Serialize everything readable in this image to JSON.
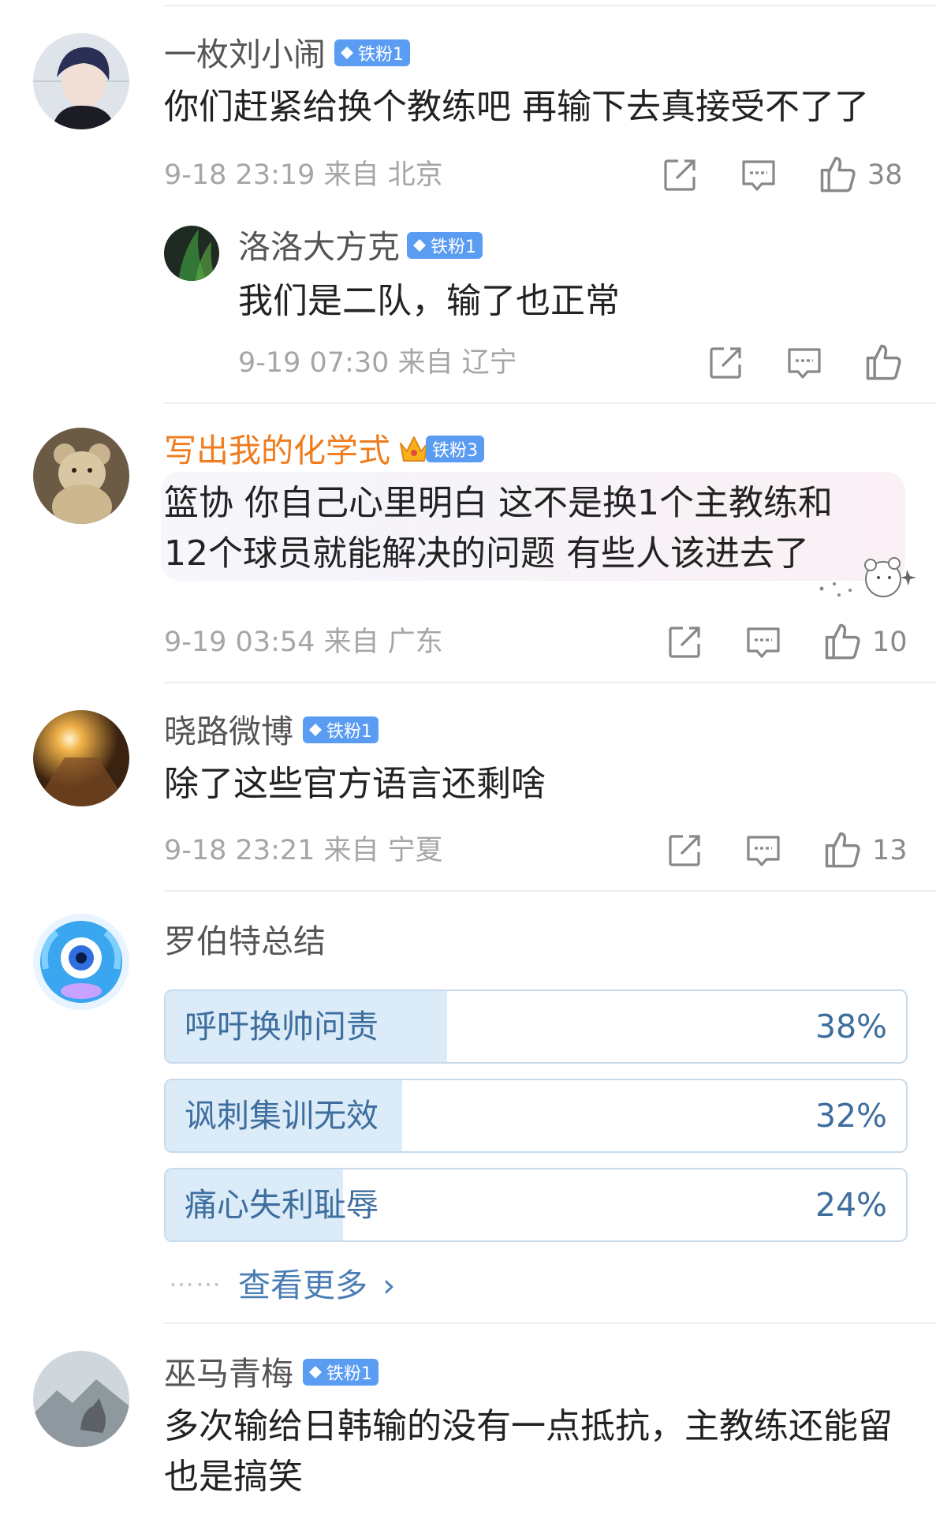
{
  "comments": [
    {
      "username": "一枚刘小闹",
      "badge": "铁粉1",
      "text": "你们赶紧给换个教练吧 再输下去真接受不了了",
      "meta": "9-18 23:19 来自 北京",
      "likes": "38",
      "reply": {
        "username": "洛洛大方克",
        "badge": "铁粉1",
        "text": "我们是二队，输了也正常",
        "meta": "9-19 07:30 来自 辽宁"
      }
    },
    {
      "username": "写出我的化学式",
      "badge": "铁粉3",
      "text_line1": "篮协  你自己心里明白  这不是换1个主教练和",
      "text_line2": "12个球员就能解决的问题  有些人该进去了",
      "meta": "9-19 03:54 来自 广东",
      "likes": "10"
    },
    {
      "username": "晓路微博",
      "badge": "铁粉1",
      "text": "除了这些官方语言还剩啥",
      "meta": "9-18 23:21 来自 宁夏",
      "likes": "13"
    }
  ],
  "summary": {
    "username": "罗伯特总结",
    "options": [
      {
        "label": "呼吁换帅问责",
        "percent": "38%",
        "fraction": 0.38
      },
      {
        "label": "讽刺集训无效",
        "percent": "32%",
        "fraction": 0.32
      },
      {
        "label": "痛心失利耻辱",
        "percent": "24%",
        "fraction": 0.24
      }
    ],
    "dots": "……",
    "see_more": "查看更多",
    "see_more_chevron": "›"
  },
  "last_comment": {
    "username": "巫马青梅",
    "badge": "铁粉1",
    "text_line1": "多次输给日韩输的没有一点抵抗，主教练还能留",
    "text_line2": "也是搞笑"
  },
  "colors": {
    "badge_blue": "#5b9cf3",
    "orange_name": "#f07c1e",
    "link_blue": "#4a7db5",
    "vote_fill": "#dcebf8"
  },
  "icons": [
    "share-icon",
    "comment-icon",
    "like-icon",
    "diamond-icon",
    "crown-icon"
  ]
}
